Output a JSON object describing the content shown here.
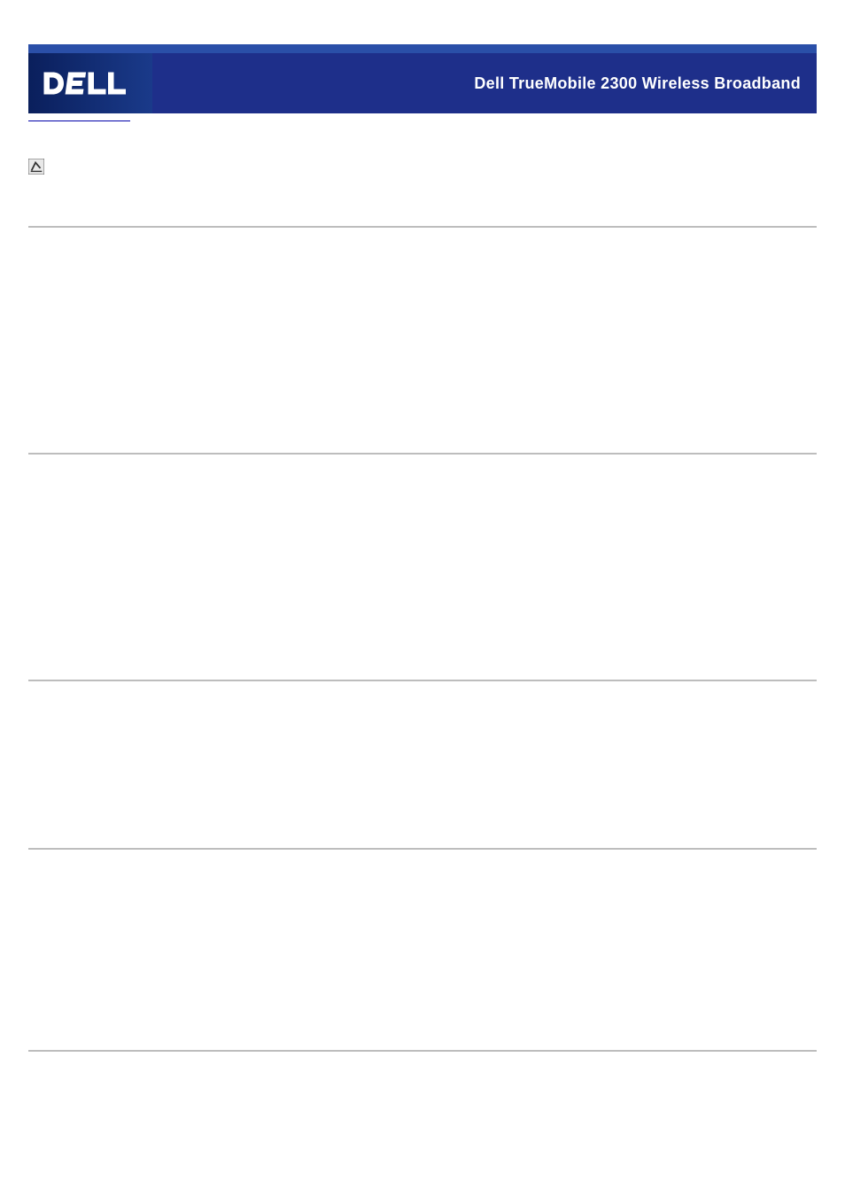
{
  "banner": {
    "title": "Dell TrueMobile 2300 Wireless Broadband",
    "logo_alt": "DELL"
  },
  "content": {
    "link_text": "              ",
    "note_text": ""
  }
}
